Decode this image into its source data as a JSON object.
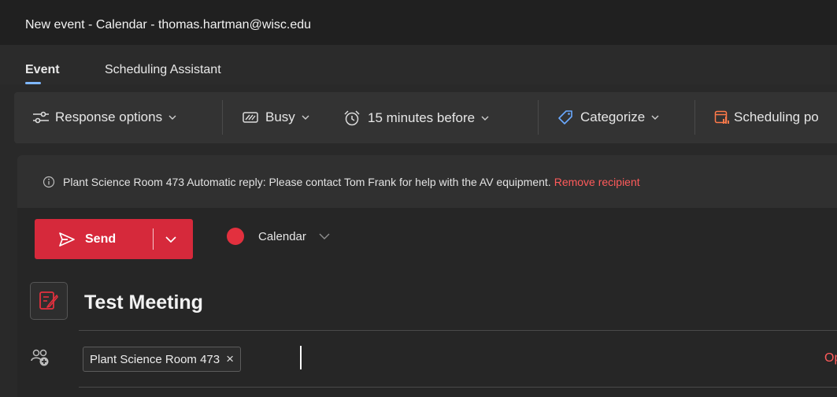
{
  "window": {
    "title": "New event - Calendar - thomas.hartman@wisc.edu"
  },
  "tabs": [
    {
      "label": "Event",
      "active": true
    },
    {
      "label": "Scheduling Assistant",
      "active": false
    }
  ],
  "toolbar": {
    "response_options": "Response options",
    "busy": "Busy",
    "reminder": "15 minutes before",
    "categorize": "Categorize",
    "scheduling": "Scheduling po"
  },
  "infobar": {
    "message": "Plant Science Room 473 Automatic reply: Please contact Tom Frank for help with the AV equipment.",
    "link": "Remove recipient"
  },
  "compose": {
    "send_label": "Send",
    "calendar_label": "Calendar",
    "calendar_color": "#e2303e",
    "title": "Test Meeting",
    "attendee_chip": "Plant Science Room 473",
    "options_link": "Opti"
  },
  "colors": {
    "accent": "#d6293b",
    "link": "#ff5b5b",
    "tab_underline": "#7fb7ff"
  }
}
